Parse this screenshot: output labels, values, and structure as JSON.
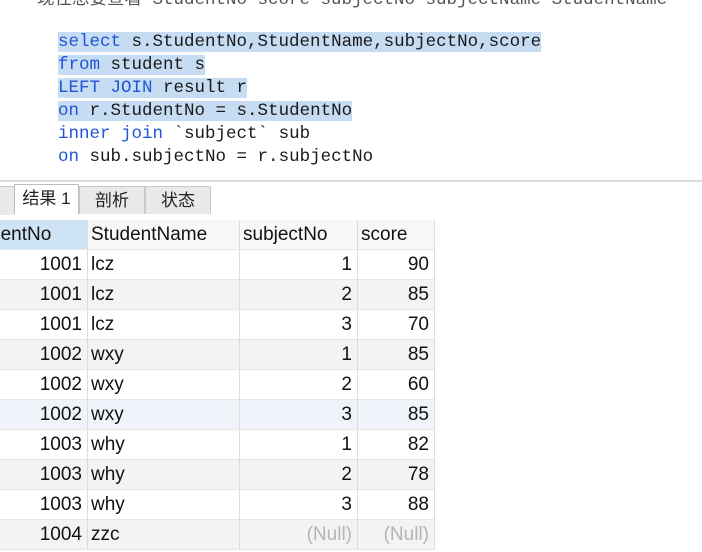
{
  "editor": {
    "cut_line": "  现在想要查看 StudentNo score subjectNo subjectName StudentName",
    "lines": [
      {
        "kw": "select",
        "rest": " s.StudentNo,StudentName,subjectNo,score"
      },
      {
        "kw": "from",
        "rest": " student s"
      },
      {
        "kw": "LEFT JOIN",
        "rest": " result r"
      },
      {
        "kw": "on",
        "rest": " r.StudentNo = s.StudentNo"
      },
      {
        "kw": "inner join",
        "rest": " `subject` sub"
      },
      {
        "kw": "on",
        "rest": " sub.subjectNo = r.subjectNo"
      }
    ]
  },
  "tabs": {
    "result": "结果 1",
    "profile": "剖析",
    "status": "状态"
  },
  "grid": {
    "columns": [
      "dentNo",
      "StudentName",
      "subjectNo",
      "score"
    ],
    "rows": [
      [
        "1001",
        "lcz",
        "1",
        "90"
      ],
      [
        "1001",
        "lcz",
        "2",
        "85"
      ],
      [
        "1001",
        "lcz",
        "3",
        "70"
      ],
      [
        "1002",
        "wxy",
        "1",
        "85"
      ],
      [
        "1002",
        "wxy",
        "2",
        "60"
      ],
      [
        "1002",
        "wxy",
        "3",
        "85"
      ],
      [
        "1003",
        "why",
        "1",
        "82"
      ],
      [
        "1003",
        "why",
        "2",
        "78"
      ],
      [
        "1003",
        "why",
        "3",
        "88"
      ],
      [
        "1004",
        "zzc",
        "(Null)",
        "(Null)"
      ]
    ]
  },
  "colors": {
    "keyword": "#1f55d6",
    "selection": "#c6dcf3",
    "null_text": "#b5b5b5"
  }
}
